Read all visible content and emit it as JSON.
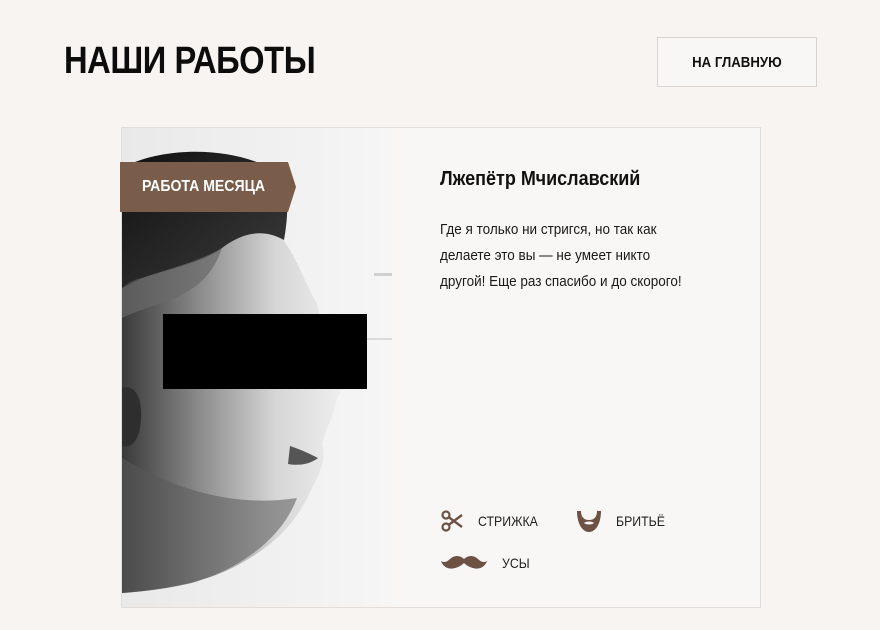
{
  "header": {
    "title": "НАШИ РАБОТЫ",
    "home_button": "НА ГЛАВНУЮ"
  },
  "card": {
    "ribbon": "РАБОТА МЕСЯЦА",
    "author": "Лжепётр Мчиславский",
    "review_lines": [
      "Где я только ни стригся, но так как",
      "делаете это вы — не умеет никто",
      "другой! Еще раз спасибо и до скорого!"
    ],
    "services": [
      {
        "label": "СТРИЖКА",
        "icon": "scissors-icon"
      },
      {
        "label": "БРИТЬЁ",
        "icon": "beard-icon"
      },
      {
        "label": "УСЫ",
        "icon": "mustache-icon"
      }
    ]
  },
  "colors": {
    "background": "#f7f4f1",
    "accent": "#7a5c4a",
    "icon": "#6d5244",
    "censor": "#000000"
  }
}
